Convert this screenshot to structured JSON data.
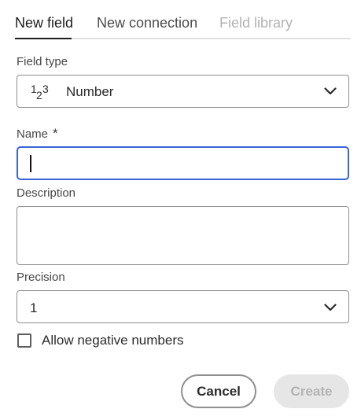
{
  "tabs": [
    {
      "label": "New field",
      "state": "active"
    },
    {
      "label": "New connection",
      "state": "normal"
    },
    {
      "label": "Field library",
      "state": "disabled"
    }
  ],
  "field_type": {
    "label": "Field type",
    "value": "Number",
    "icon": "number-123-icon"
  },
  "name": {
    "label": "Name",
    "required_marker": "*",
    "value": ""
  },
  "description": {
    "label": "Description",
    "value": ""
  },
  "precision": {
    "label": "Precision",
    "value": "1"
  },
  "allow_negative": {
    "label": "Allow negative numbers",
    "checked": false
  },
  "buttons": {
    "cancel": "Cancel",
    "create": "Create"
  },
  "colors": {
    "focus": "#3b63d6",
    "disabled_bg": "#e6e6e6",
    "disabled_text": "#b3b3b3"
  }
}
